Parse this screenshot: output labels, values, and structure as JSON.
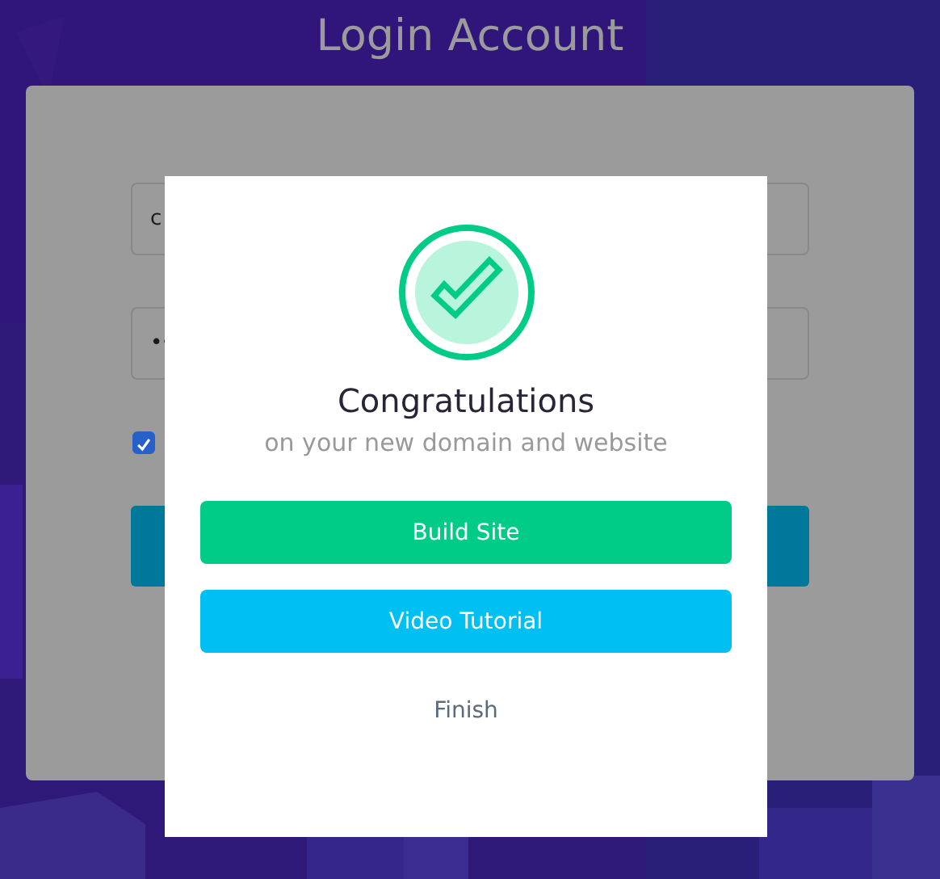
{
  "page": {
    "title": "Login Account"
  },
  "login_form": {
    "username": {
      "value": "c"
    },
    "password": {
      "value": "••"
    },
    "remember": {
      "checked": true
    }
  },
  "modal": {
    "title": "Congratulations",
    "subtitle": "on your new domain and website",
    "buttons": [
      {
        "label": "Build Site",
        "kind": "primary"
      },
      {
        "label": "Video Tutorial",
        "kind": "secondary"
      },
      {
        "label": "Finish",
        "kind": "link"
      }
    ]
  }
}
